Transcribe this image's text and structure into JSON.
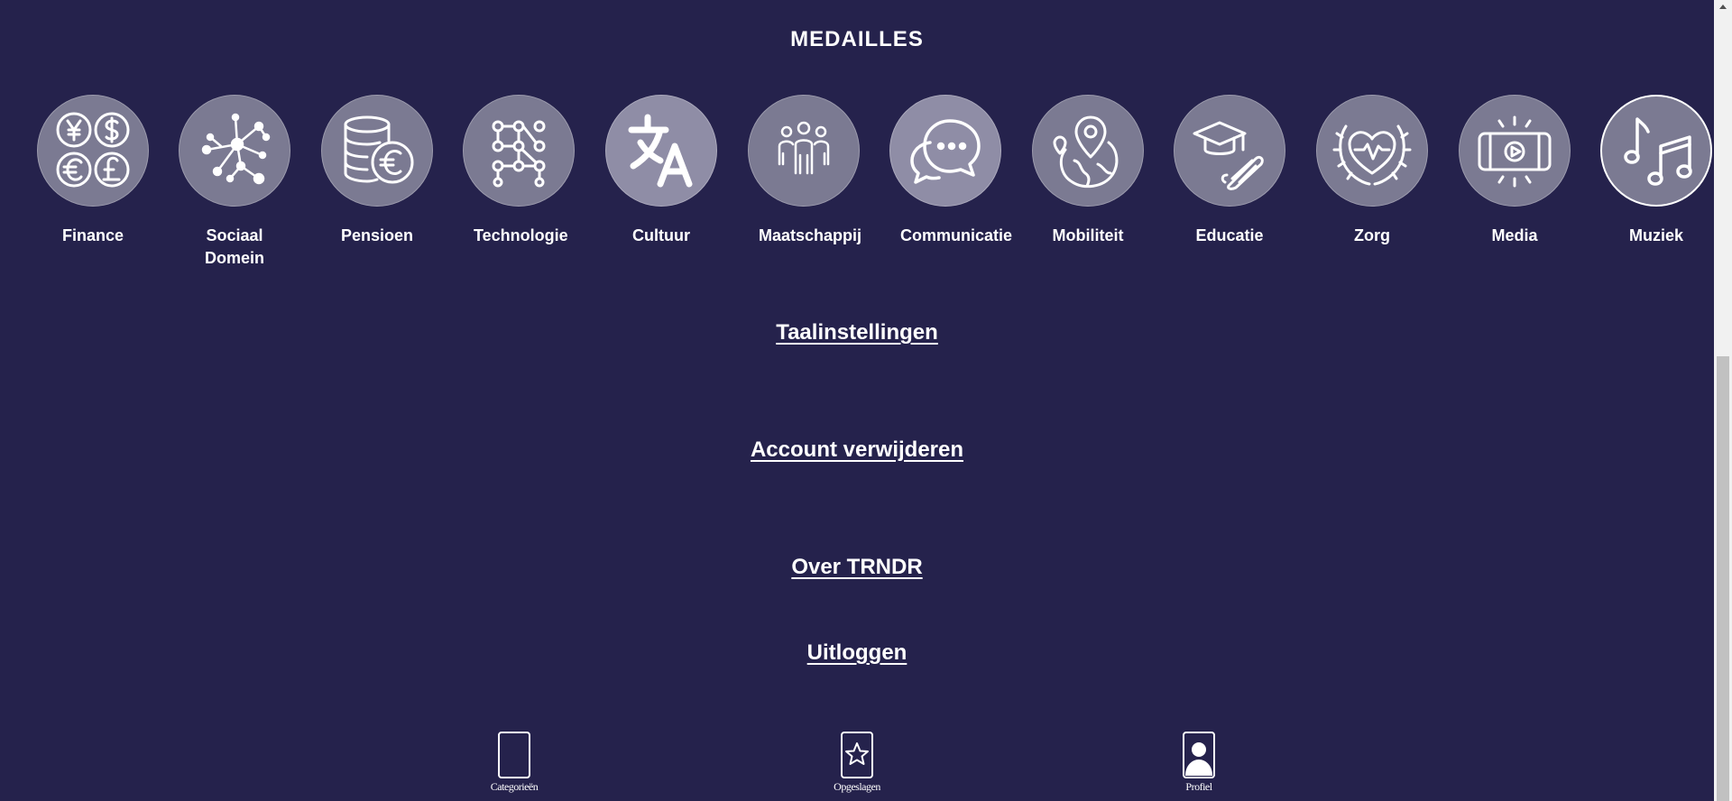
{
  "medals": {
    "title": "MEDAILLES",
    "items": [
      {
        "label": "Finance",
        "icon": "currency-icon"
      },
      {
        "label": "Sociaal Domein",
        "icon": "network-icon"
      },
      {
        "label": "Pensioen",
        "icon": "coins-euro-icon"
      },
      {
        "label": "Technologie",
        "icon": "circuit-icon"
      },
      {
        "label": "Cultuur",
        "icon": "translate-icon"
      },
      {
        "label": "Maatschappij",
        "icon": "people-icon"
      },
      {
        "label": "Communicatie",
        "icon": "chat-bubbles-icon"
      },
      {
        "label": "Mobiliteit",
        "icon": "globe-pin-icon"
      },
      {
        "label": "Educatie",
        "icon": "graduation-cap-icon"
      },
      {
        "label": "Zorg",
        "icon": "heart-laurel-icon"
      },
      {
        "label": "Media",
        "icon": "video-play-icon"
      },
      {
        "label": "Muziek",
        "icon": "music-notes-icon"
      }
    ]
  },
  "links": {
    "language": "Taalinstellingen",
    "delete_account": "Account verwijderen",
    "about": "Over TRNDR",
    "logout": "Uitloggen"
  },
  "bottom_nav": {
    "categories": "Categorieën",
    "saved": "Opgeslagen",
    "profile": "Profiel"
  },
  "colors": {
    "background": "#25224c",
    "medal_fill": "#7b7a92",
    "text": "#ffffff"
  }
}
